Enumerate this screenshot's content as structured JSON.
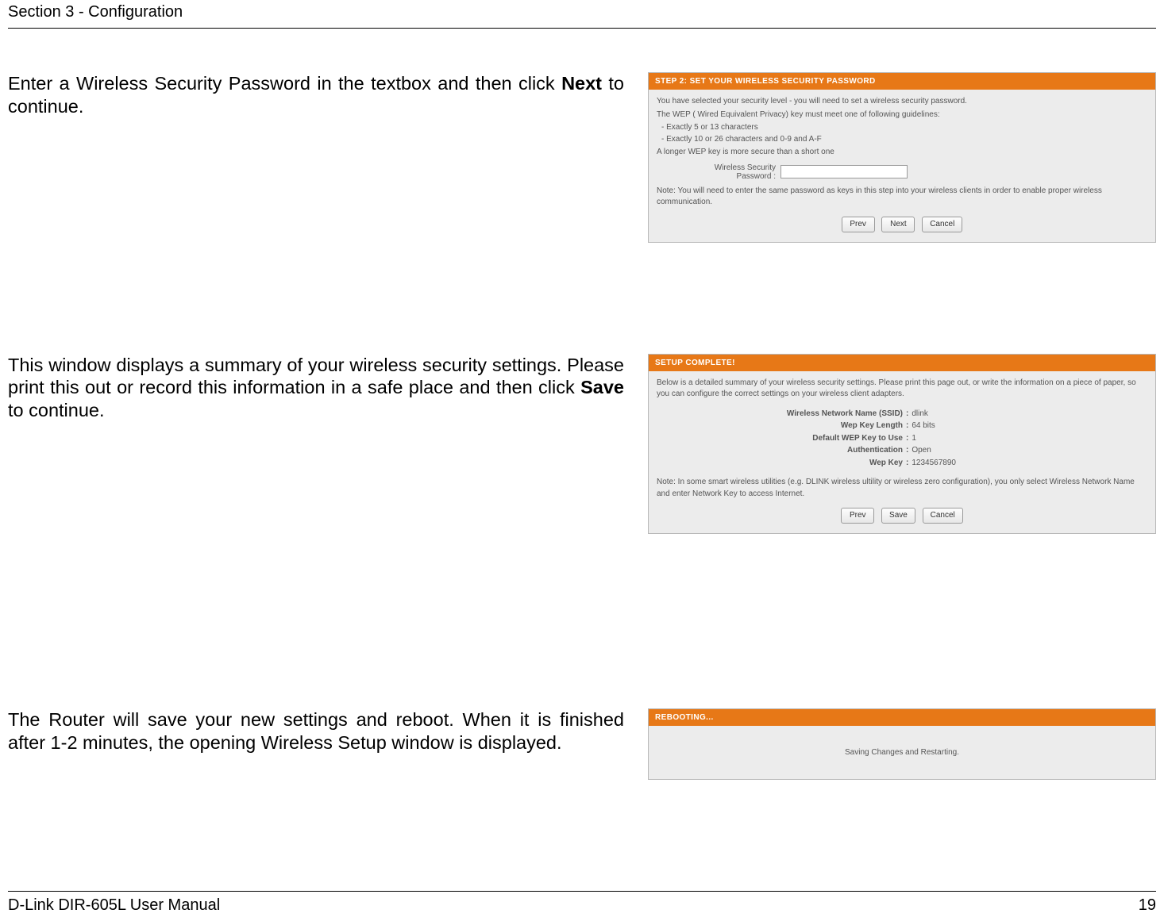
{
  "header": {
    "section": "Section 3 - Configuration"
  },
  "footer": {
    "manual": "D-Link DIR-605L User Manual",
    "page": "19"
  },
  "step1": {
    "desc_pre": "Enter a Wireless Security Password in the textbox and then click ",
    "desc_bold": "Next",
    "desc_post": " to continue.",
    "panel": {
      "title": "STEP 2: SET YOUR WIRELESS SECURITY PASSWORD",
      "line1": "You have selected your security level - you will need to set a wireless security password.",
      "line2": "The WEP ( Wired Equivalent Privacy) key must meet one of following guidelines:",
      "bullets": [
        "Exactly 5 or 13 characters",
        "Exactly 10 or 26 characters and 0-9 and A-F"
      ],
      "line3": "A longer WEP key is more secure than a short one",
      "field_label": "Wireless Security Password :",
      "field_value": "",
      "note": "Note: You will need to enter the same password as keys in this step into your wireless clients in order to enable proper wireless communication.",
      "buttons": {
        "prev": "Prev",
        "next": "Next",
        "cancel": "Cancel"
      }
    }
  },
  "step2": {
    "desc_pre": "This window displays a summary of your wireless security settings. Please print this out or record this information in a safe place and then click ",
    "desc_bold": "Save",
    "desc_post": " to continue.",
    "panel": {
      "title": "SETUP COMPLETE!",
      "intro": "Below is a detailed summary of your wireless security settings. Please print this page out, or write the information on a piece of paper, so you can configure the correct settings on your wireless client adapters.",
      "kv": {
        "ssid_k": "Wireless Network Name (SSID)",
        "ssid_v": "dlink",
        "len_k": "Wep Key Length",
        "len_v": "64 bits",
        "def_k": "Default WEP Key to Use",
        "def_v": "1",
        "auth_k": "Authentication",
        "auth_v": "Open",
        "key_k": "Wep Key",
        "key_v": "1234567890"
      },
      "note": "Note: In some smart wireless utilities (e.g. DLINK wireless ultility or wireless zero configuration), you only select Wireless Network Name and enter Network Key to access Internet.",
      "buttons": {
        "prev": "Prev",
        "save": "Save",
        "cancel": "Cancel"
      }
    }
  },
  "step3": {
    "desc": "The Router will save your new settings and reboot. When it is finished after 1-2 minutes, the opening Wireless Setup window is displayed.",
    "panel": {
      "title": "REBOOTING...",
      "body": "Saving Changes and Restarting."
    }
  }
}
